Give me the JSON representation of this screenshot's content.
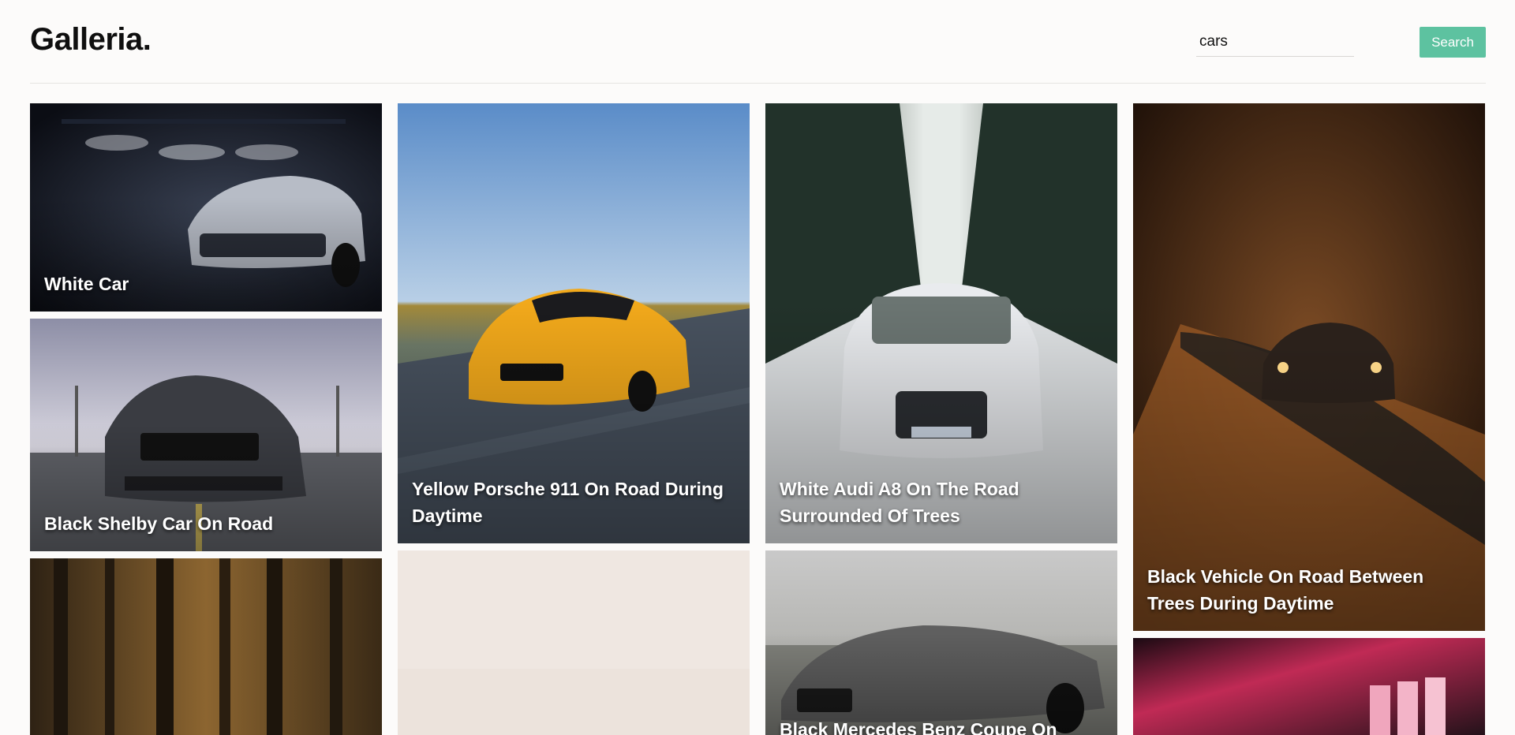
{
  "header": {
    "logo": "Galleria.",
    "search_value": "cars",
    "search_button": "Search"
  },
  "colors": {
    "accent": "#5dc2a0",
    "background": "#fcfbfa"
  },
  "gallery": {
    "items": [
      {
        "title": "White Car"
      },
      {
        "title": "Black Shelby Car On Road"
      },
      {
        "title": ""
      },
      {
        "title": "Yellow Porsche 911 On Road During Daytime"
      },
      {
        "title": ""
      },
      {
        "title": "White Audi A8 On The Road Surrounded Of Trees"
      },
      {
        "title": "Black Mercedes Benz Coupe On"
      },
      {
        "title": "Black Vehicle On Road Between Trees During Daytime"
      },
      {
        "title": ""
      }
    ]
  }
}
